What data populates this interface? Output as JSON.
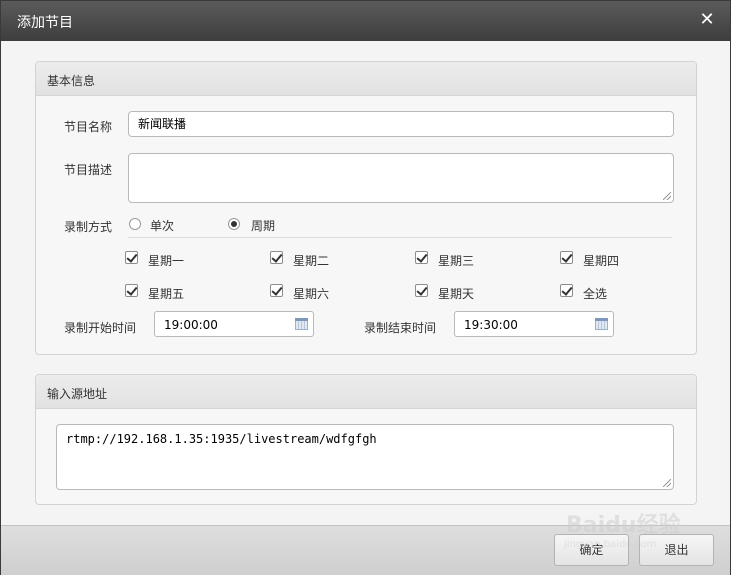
{
  "dialog": {
    "title": "添加节目",
    "close_glyph": "✕"
  },
  "basic_info": {
    "section_title": "基本信息",
    "name_label": "节目名称",
    "name_value": "新闻联播",
    "desc_label": "节目描述",
    "desc_value": "",
    "mode_label": "录制方式",
    "mode_options": [
      {
        "label": "单次",
        "selected": false
      },
      {
        "label": "周期",
        "selected": true
      }
    ],
    "days": [
      {
        "label": "星期一",
        "checked": true
      },
      {
        "label": "星期二",
        "checked": true
      },
      {
        "label": "星期三",
        "checked": true
      },
      {
        "label": "星期四",
        "checked": true
      },
      {
        "label": "星期五",
        "checked": true
      },
      {
        "label": "星期六",
        "checked": true
      },
      {
        "label": "星期天",
        "checked": true
      },
      {
        "label": "全选",
        "checked": true
      }
    ],
    "start_label": "录制开始时间",
    "start_value": "19:00:00",
    "end_label": "录制结束时间",
    "end_value": "19:30:00",
    "calendar_icon": "calendar-icon"
  },
  "source": {
    "section_title": "输入源地址",
    "url_value": "rtmp://192.168.1.35:1935/livestream/wdfgfgh"
  },
  "footer": {
    "confirm_label": "确定",
    "exit_label": "退出"
  },
  "watermark": {
    "text": "Baidu经验",
    "sub": "jingyan.baidu.com"
  }
}
